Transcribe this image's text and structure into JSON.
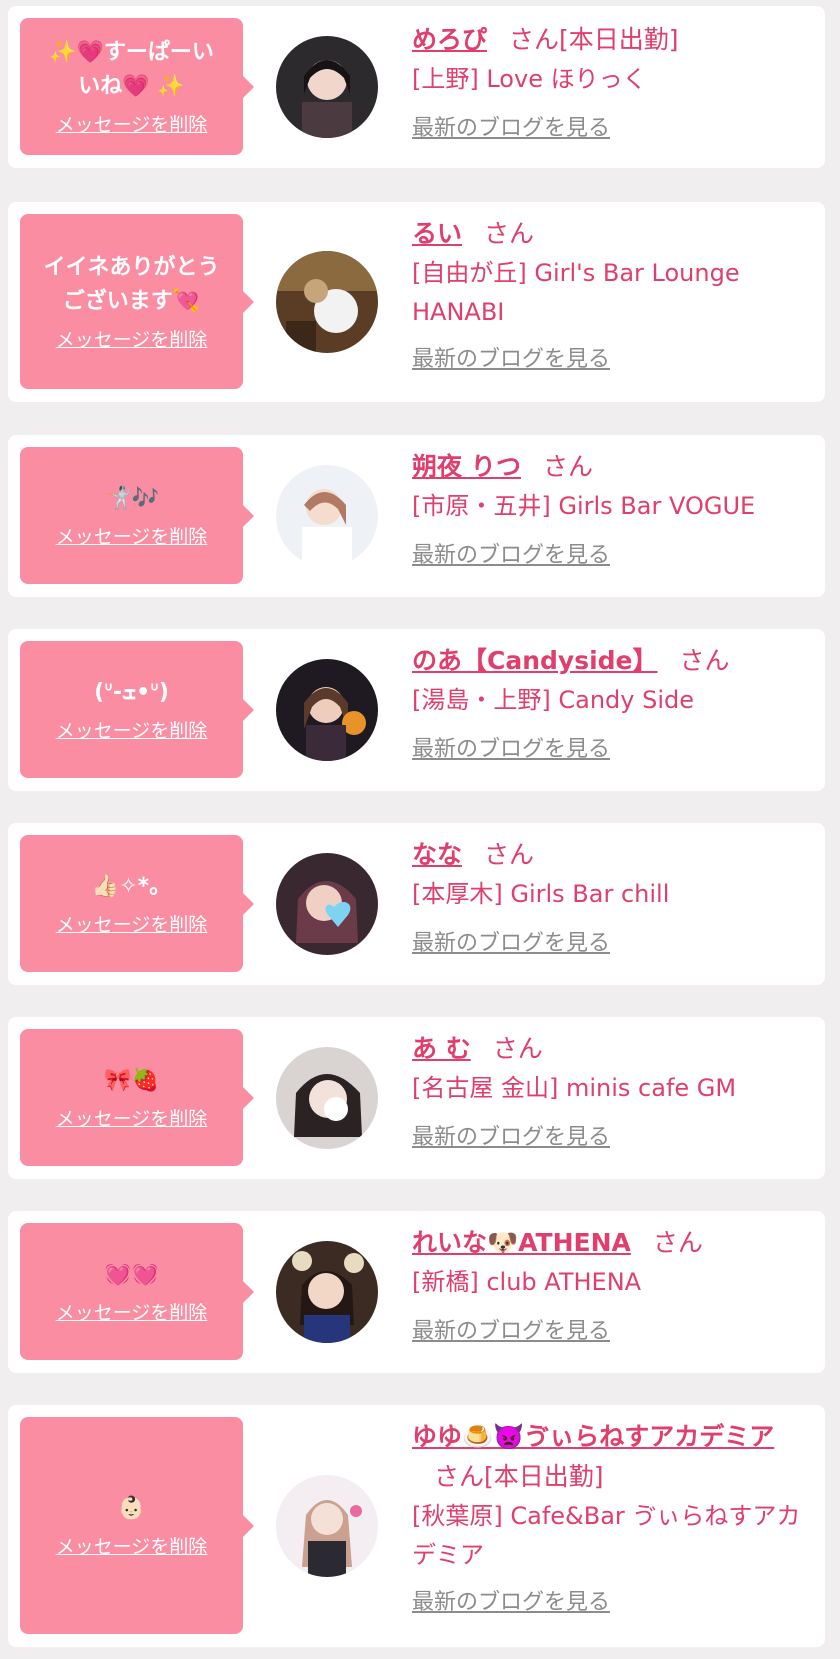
{
  "delete_label": "メッセージを削除",
  "san_label": "さん",
  "blog_label": "最新のブログを見る",
  "colors": {
    "accent": "#e03e6c",
    "bubble": "#fb8da3",
    "link_gray": "#8c8c8c",
    "background": "#f0eeef",
    "card": "#ffffff"
  },
  "items": [
    {
      "message": "✨💗すーぱーい\nいね💗 ✨",
      "name": "めろぴ",
      "status": "[本日出勤]",
      "shop": "[上野] Love ほりっく"
    },
    {
      "message": "イイネありがとう\nございます💘",
      "name": "るい",
      "status": "",
      "shop": "[自由が丘] Girl's Bar Lounge HANABI"
    },
    {
      "message": "🤺🎶",
      "name": "朔夜 りつ",
      "status": "",
      "shop": "[市原・五井] Girls Bar VOGUE"
    },
    {
      "message": "(ᐡ-ܫ•ᐡ)",
      "name": "のあ【Candyside】",
      "status": "",
      "shop": "[湯島・上野] Candy Side"
    },
    {
      "message": "👍🏻✧︎*。",
      "name": "なな",
      "status": "",
      "shop": "[本厚木] Girls Bar chill"
    },
    {
      "message": "🎀🍓",
      "name": "あ む",
      "status": "",
      "shop": "[名古屋 金山] minis cafe GM"
    },
    {
      "message": "💓💓",
      "name": "れいな🐶ATHENA",
      "status": "",
      "shop": "[新橋] club ATHENA"
    },
    {
      "message": "👶🏻",
      "name": "ゆゆ🍮👿ゔぃらねすアカデミア",
      "status": "[本日出勤]",
      "shop": "[秋葉原] Cafe&Bar ゔぃらねすアカデミア"
    }
  ]
}
